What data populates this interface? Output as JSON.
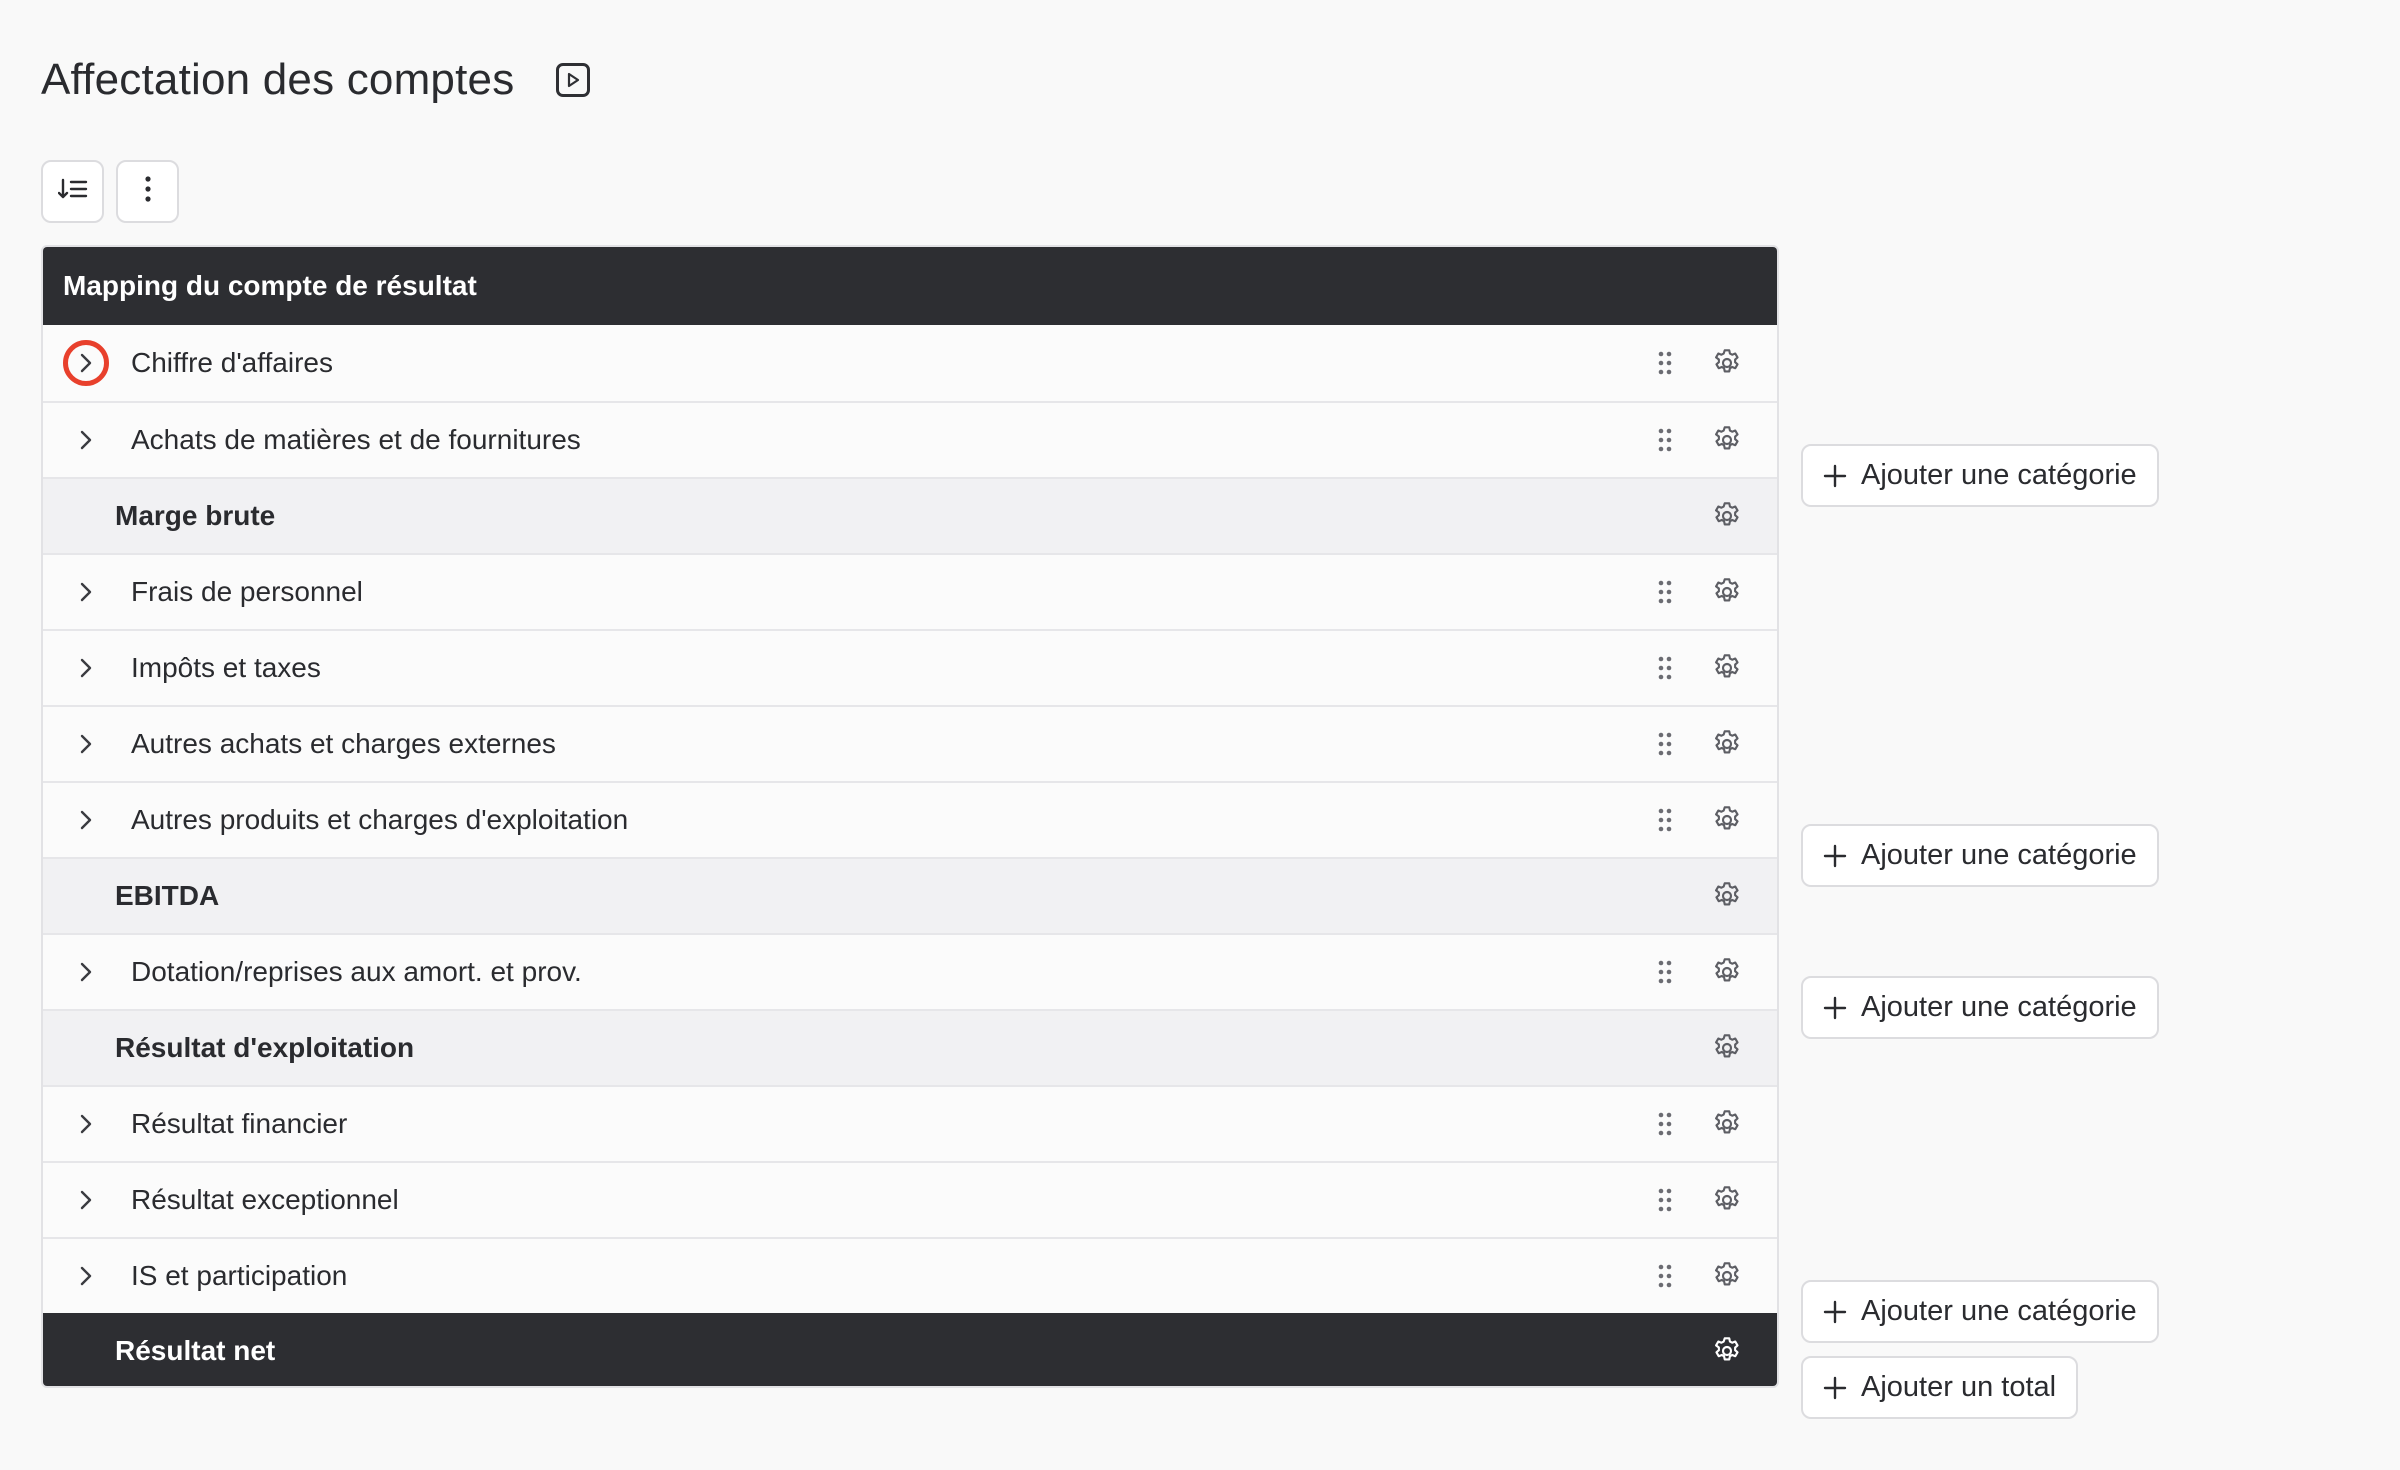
{
  "page": {
    "title": "Affectation des comptes",
    "video_icon": "play-video-icon"
  },
  "toolbar": {
    "sort_icon": "sort-list-icon",
    "more_icon": "more-vertical-icon"
  },
  "table": {
    "header": "Mapping du compte de résultat",
    "rows": [
      {
        "label": "Chiffre d'affaires",
        "type": "category"
      },
      {
        "label": "Achats de matières et de fournitures",
        "type": "category"
      },
      {
        "label": "Marge brute",
        "type": "total"
      },
      {
        "label": "Frais de personnel",
        "type": "category"
      },
      {
        "label": "Impôts et taxes",
        "type": "category"
      },
      {
        "label": "Autres achats et charges externes",
        "type": "category"
      },
      {
        "label": "Autres produits et charges d'exploitation",
        "type": "category"
      },
      {
        "label": "EBITDA",
        "type": "total"
      },
      {
        "label": "Dotation/reprises aux amort. et prov.",
        "type": "category"
      },
      {
        "label": "Résultat d'exploitation",
        "type": "total"
      },
      {
        "label": "Résultat financier",
        "type": "category"
      },
      {
        "label": "Résultat exceptionnel",
        "type": "category"
      },
      {
        "label": "IS et participation",
        "type": "category"
      },
      {
        "label": "Résultat net",
        "type": "grand-total"
      }
    ]
  },
  "actions": {
    "add_category_1": "Ajouter une catégorie",
    "add_category_2": "Ajouter une catégorie",
    "add_category_3": "Ajouter une catégorie",
    "add_category_4": "Ajouter une catégorie",
    "add_total": "Ajouter un total"
  },
  "colors": {
    "header_bg": "#2d2e32",
    "focus_ring": "#e8402c",
    "page_bg": "#f9f9f9"
  }
}
